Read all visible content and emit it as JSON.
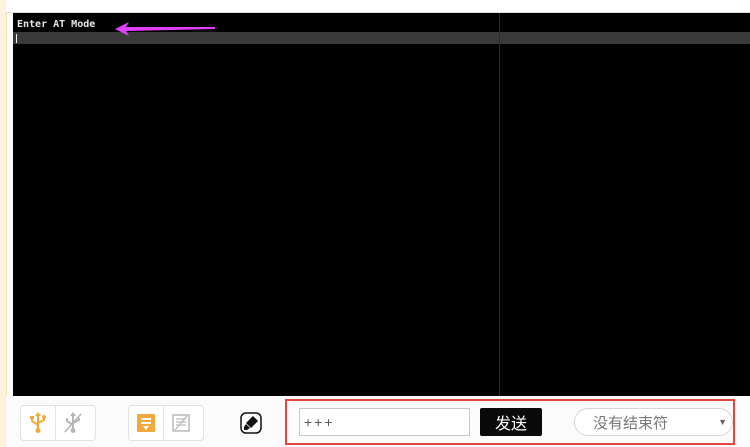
{
  "terminal": {
    "output_lines": [
      "Enter AT Mode"
    ]
  },
  "toolbar": {
    "usb_connect_icon": "usb-icon",
    "usb_disconnect_icon": "usb-disabled-icon",
    "save_log_icon": "save-log-icon",
    "clear_log_icon": "clear-log-icon",
    "tool_icon": "brush-icon"
  },
  "send_panel": {
    "command_value": "+++",
    "send_label": "发送",
    "line_ending_selected": "没有结束符"
  },
  "colors": {
    "terminal_bg": "#000000",
    "accent_orange": "#f3a83b",
    "annotation_arrow": "#e040fb",
    "highlight_box": "#e64545"
  }
}
